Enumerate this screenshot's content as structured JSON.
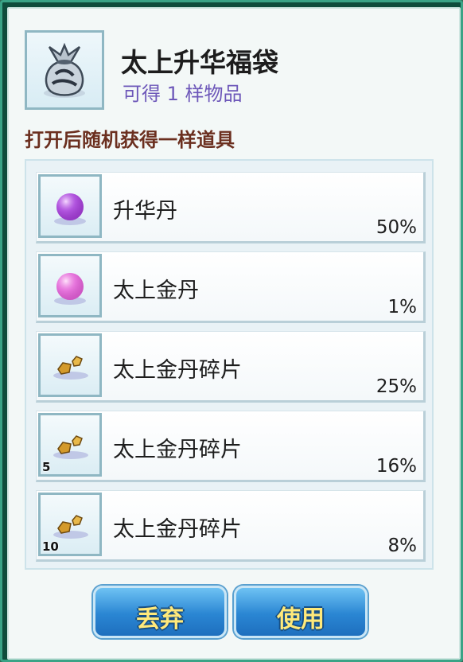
{
  "header": {
    "icon": "lucky-bag-icon",
    "title": "太上升华福袋",
    "subtitle": "可得 1 样物品"
  },
  "description": "打开后随机获得一样道具",
  "items": [
    {
      "name": "升华丹",
      "percent": "50%",
      "icon": "purple-orb-icon",
      "qty": ""
    },
    {
      "name": "太上金丹",
      "percent": "1%",
      "icon": "pink-orb-icon",
      "qty": ""
    },
    {
      "name": "太上金丹碎片",
      "percent": "25%",
      "icon": "golden-fragment-icon",
      "qty": ""
    },
    {
      "name": "太上金丹碎片",
      "percent": "16%",
      "icon": "golden-fragment-icon",
      "qty": "5"
    },
    {
      "name": "太上金丹碎片",
      "percent": "8%",
      "icon": "golden-fragment-icon",
      "qty": "10"
    }
  ],
  "buttons": {
    "discard": "丢弃",
    "use": "使用"
  },
  "colors": {
    "subtitle": "#6d57b9",
    "description": "#6b2f1f",
    "button": "#2a86d3",
    "button_text": "#ffe97a"
  }
}
